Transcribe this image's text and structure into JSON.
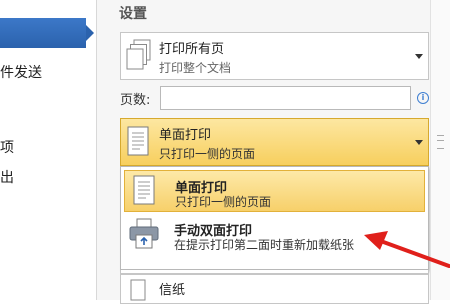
{
  "nav": {
    "items": [
      {
        "label": "件发送"
      },
      {
        "label": "项"
      },
      {
        "label": "出"
      }
    ]
  },
  "settings": {
    "title": "设置",
    "print_range": {
      "title": "打印所有页",
      "subtitle": "打印整个文档"
    },
    "pages": {
      "label": "页数:",
      "value": "",
      "info_glyph": "i"
    },
    "sides": {
      "title": "单面打印",
      "subtitle": "只打印一侧的页面"
    },
    "sides_options": [
      {
        "title": "单面打印",
        "subtitle": "只打印一侧的页面",
        "selected": true
      },
      {
        "title": "手动双面打印",
        "subtitle": "在提示打印第二面时重新加载纸张",
        "selected": false
      }
    ],
    "paper": {
      "title": "信纸"
    }
  },
  "colors": {
    "nav_selected": "#2b62ad",
    "highlight": "#f7cf5e",
    "annotation_arrow": "#e0201b"
  }
}
